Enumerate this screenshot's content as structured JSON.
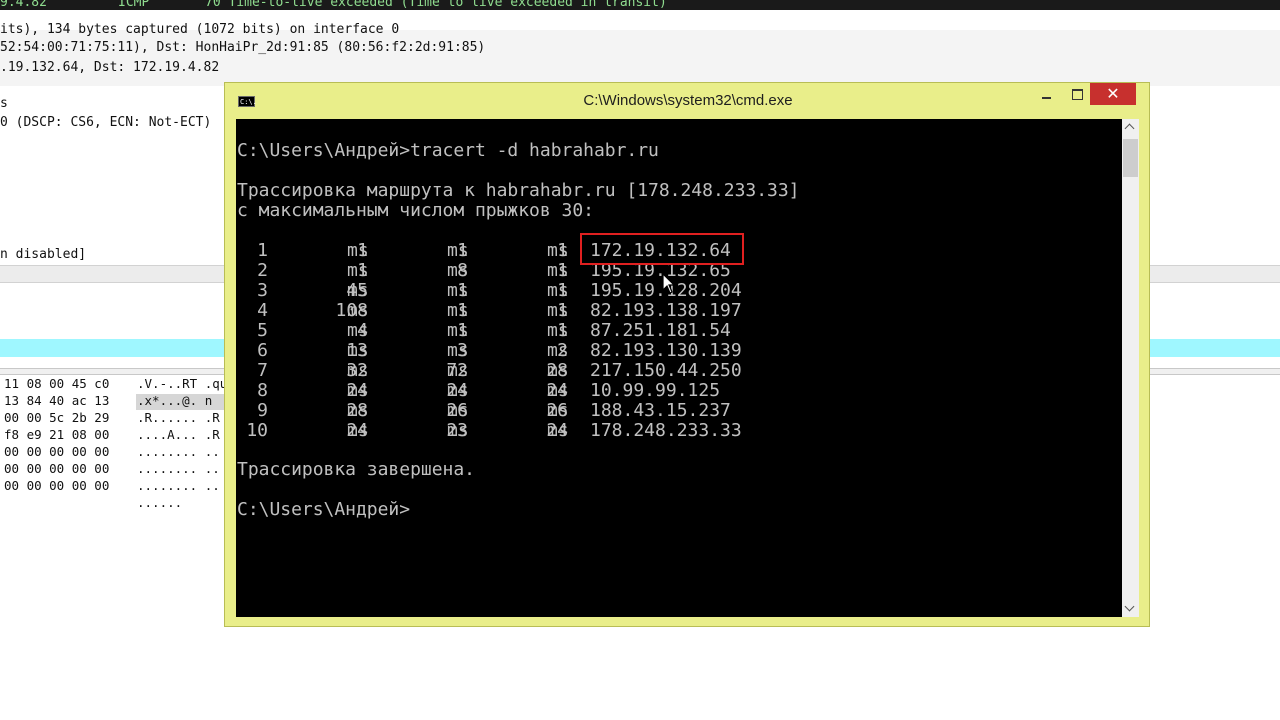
{
  "wireshark": {
    "top_row": {
      "left": "9.4.82",
      "protocol": "ICMP",
      "info": "70 Time-to-live exceeded (Time to live exceeded in transit)"
    },
    "details": [
      "its), 134 bytes captured (1072 bits) on interface 0",
      "52:54:00:71:75:11), Dst: HonHaiPr_2d:91:85 (80:56:f2:2d:91:85)",
      ".19.132.64, Dst: 172.19.4.82",
      "s",
      "0 (DSCP: CS6, ECN: Not-ECT)",
      "n disabled]"
    ],
    "hex": [
      "11 08 00 45 c0",
      "13 84 40 ac 13",
      "00 00 5c 2b 29",
      "f8 e9 21 08 00",
      "00 00 00 00 00",
      "00 00 00 00 00",
      "00 00 00 00 00"
    ],
    "ascii": [
      ".V.-..RT .qu",
      ".x*...@. n",
      ".R...... .R",
      "....A... .R",
      "........ ..",
      "........ ..",
      "........ ..",
      "......"
    ]
  },
  "cmd": {
    "title": "C:\\Windows\\system32\\cmd.exe",
    "icon_text": "C:\\.",
    "close_symbol": "✕",
    "command_line": "C:\\Users\\Андрей>tracert -d habrahabr.ru",
    "trace_header_1": "Трассировка маршрута к habrahabr.ru [178.248.233.33]",
    "trace_header_2": "с максимальным числом прыжков 30:",
    "ms": "ms",
    "hops": [
      {
        "hop": "1",
        "t1": "1",
        "t2": "1",
        "t3": "1",
        "ip": "172.19.132.64"
      },
      {
        "hop": "2",
        "t1": "1",
        "t2": "8",
        "t3": "1",
        "ip": "195.19.132.65"
      },
      {
        "hop": "3",
        "t1": "45",
        "t2": "1",
        "t3": "1",
        "ip": "195.19.128.204"
      },
      {
        "hop": "4",
        "t1": "108",
        "t2": "1",
        "t3": "1",
        "ip": "82.193.138.197"
      },
      {
        "hop": "5",
        "t1": "4",
        "t2": "1",
        "t3": "1",
        "ip": "87.251.181.54"
      },
      {
        "hop": "6",
        "t1": "13",
        "t2": "3",
        "t3": "2",
        "ip": "82.193.130.139"
      },
      {
        "hop": "7",
        "t1": "32",
        "t2": "72",
        "t3": "28",
        "ip": "217.150.44.250"
      },
      {
        "hop": "8",
        "t1": "24",
        "t2": "24",
        "t3": "24",
        "ip": "10.99.99.125"
      },
      {
        "hop": "9",
        "t1": "28",
        "t2": "26",
        "t3": "26",
        "ip": "188.43.15.237"
      },
      {
        "hop": "10",
        "t1": "24",
        "t2": "23",
        "t3": "24",
        "ip": "178.248.233.33"
      }
    ],
    "trace_done": "Трассировка завершена.",
    "prompt": "C:\\Users\\Андрей>"
  }
}
